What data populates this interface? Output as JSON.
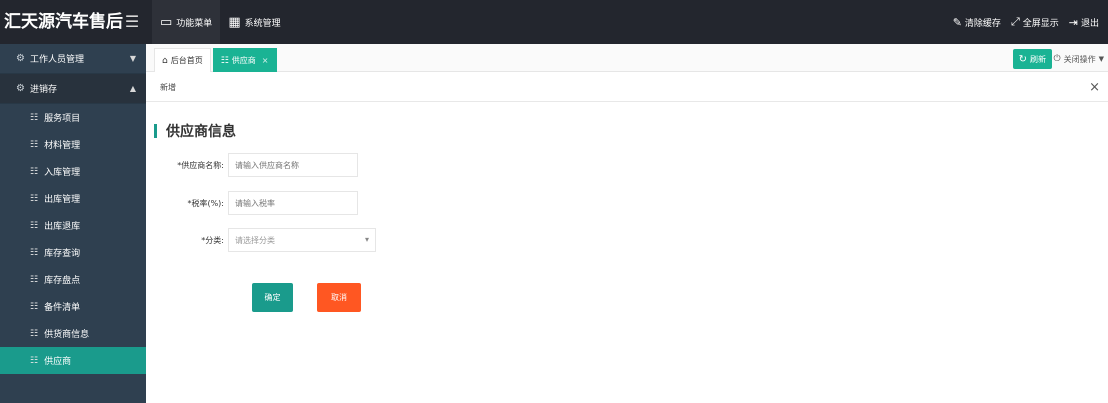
{
  "app": {
    "title": "汇天源汽车售后",
    "menu_toggle_icon": "hamburger-icon"
  },
  "topnav": [
    {
      "label": "功能菜单",
      "icon": "monitor-icon",
      "active": true
    },
    {
      "label": "系统管理",
      "icon": "grid-icon",
      "active": false
    }
  ],
  "topright": [
    {
      "label": "清除缓存",
      "icon": "brush-icon"
    },
    {
      "label": "全屏显示",
      "icon": "expand-icon"
    },
    {
      "label": "退出",
      "icon": "logout-icon"
    }
  ],
  "sidebar": {
    "groups": [
      {
        "label": "工作人员管理",
        "icon": "cog-icon",
        "open": false
      },
      {
        "label": "进销存",
        "icon": "cog-icon",
        "open": true
      }
    ],
    "items": [
      {
        "label": "服务项目",
        "active": false
      },
      {
        "label": "材料管理",
        "active": false
      },
      {
        "label": "入库管理",
        "active": false
      },
      {
        "label": "出库管理",
        "active": false
      },
      {
        "label": "出库退库",
        "active": false
      },
      {
        "label": "库存查询",
        "active": false
      },
      {
        "label": "库存盘点",
        "active": false
      },
      {
        "label": "备件清单",
        "active": false
      },
      {
        "label": "供货商信息",
        "active": false
      },
      {
        "label": "供应商",
        "active": true
      }
    ]
  },
  "tabs": [
    {
      "label": "后台首页",
      "icon": "home-icon",
      "active": false
    },
    {
      "label": "供应商",
      "icon": "list-icon",
      "active": true,
      "closable": true
    }
  ],
  "tab_actions": {
    "refresh_label": "刷新",
    "close_ops_label": "关闭操作"
  },
  "breadcrumb": {
    "label": "新增"
  },
  "form": {
    "section_title": "供应商信息",
    "fields": [
      {
        "label": "*供应商名称:",
        "placeholder": "请输入供应商名称"
      },
      {
        "label": "*税率(%):",
        "placeholder": "请输入税率"
      },
      {
        "label": "*分类:",
        "placeholder": "请选择分类"
      }
    ],
    "submit_label": "确定",
    "cancel_label": "取消"
  },
  "colors": {
    "topbar": "#23262e",
    "sidebar": "#2f4050",
    "accent": "#1a9b8c",
    "tab_active": "#1ab394",
    "cancel": "#ff5722"
  }
}
